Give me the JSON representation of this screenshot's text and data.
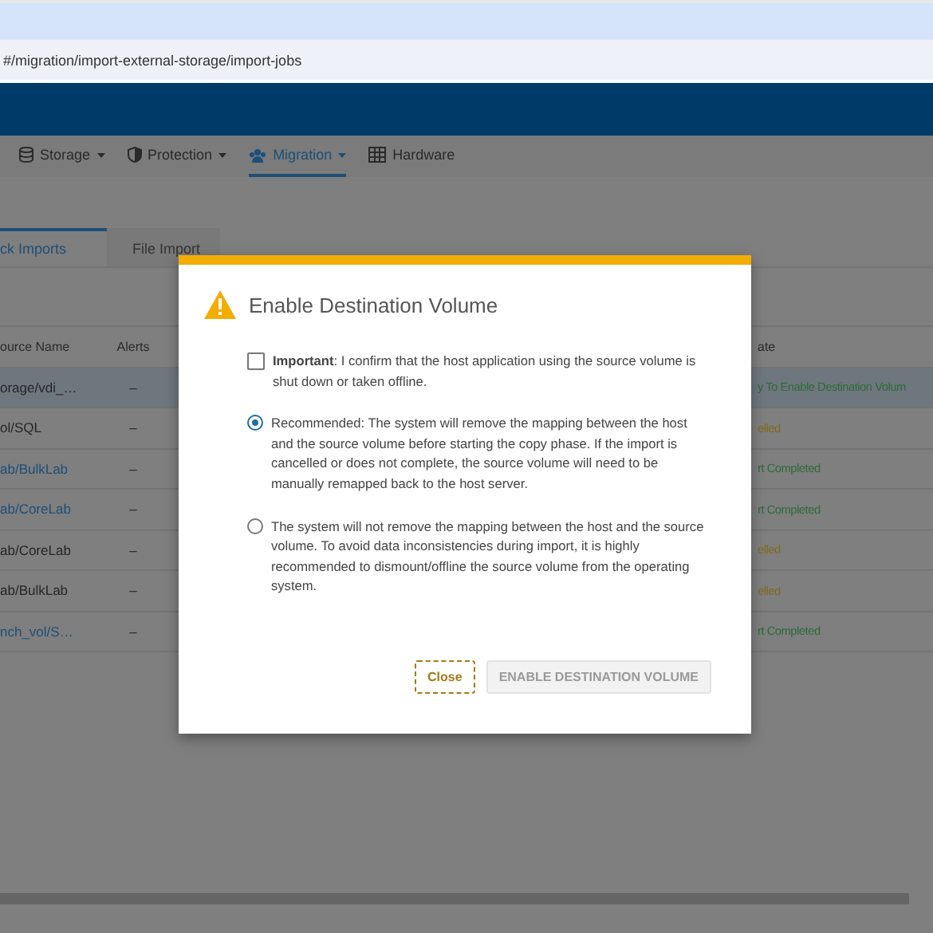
{
  "browser": {
    "address": "#/migration/import-external-storage/import-jobs"
  },
  "nav": [
    {
      "label": "Storage",
      "dropdown": true,
      "selected": false
    },
    {
      "label": "Protection",
      "dropdown": true,
      "selected": false
    },
    {
      "label": "Migration",
      "dropdown": true,
      "selected": true
    },
    {
      "label": "Hardware",
      "dropdown": false,
      "selected": false
    }
  ],
  "tabs": [
    {
      "label": "ck Imports",
      "selected": true
    },
    {
      "label": "File Import",
      "selected": false
    }
  ],
  "table": {
    "columns": [
      "ource Name",
      "Alerts",
      "ate"
    ],
    "rows": [
      {
        "source": "orage/vdi_…",
        "link": false,
        "alerts": "–",
        "state": "y To Enable Destination Volum",
        "color": "#2e6b3a",
        "selected": true
      },
      {
        "source": "ol/SQL",
        "link": false,
        "alerts": "–",
        "state": "elled",
        "color": "#7f6a1e",
        "selected": false
      },
      {
        "source": "ab/BulkLab",
        "link": true,
        "alerts": "–",
        "state": "rt Completed",
        "color": "#2e6b3a",
        "selected": false
      },
      {
        "source": "ab/CoreLab",
        "link": true,
        "alerts": "–",
        "state": "rt Completed",
        "color": "#2e6b3a",
        "selected": false
      },
      {
        "source": "ab/CoreLab",
        "link": false,
        "alerts": "–",
        "state": "elled",
        "color": "#7f6a1e",
        "selected": false
      },
      {
        "source": "ab/BulkLab",
        "link": false,
        "alerts": "–",
        "state": "elled",
        "color": "#7f6a1e",
        "selected": false
      },
      {
        "source": "nch_vol/S…",
        "link": true,
        "alerts": "–",
        "state": "rt Completed",
        "color": "#2e6b3a",
        "selected": false
      }
    ]
  },
  "dialog": {
    "title": "Enable Destination Volume",
    "options": [
      {
        "kind": "checkbox",
        "checked": false,
        "text": "**Important**: I confirm that the host application using the source volume is shut down or taken offline."
      },
      {
        "kind": "radio",
        "selected": true,
        "text": "Recommended: The system will remove the mapping between the host and the source volume before starting the copy phase. If the import is cancelled or does not complete, the source volume will need to be manually remapped back to the host server."
      },
      {
        "kind": "radio",
        "selected": false,
        "text": "The system will not remove the mapping between the host and the source volume. To avoid data inconsistencies during import, it is highly recommended to dismount/offline the source volume from the operating system."
      }
    ],
    "buttons": [
      {
        "label": "Close",
        "disabled": false
      },
      {
        "label": "ENABLE DESTINATION VOLUME",
        "disabled": true
      }
    ]
  }
}
